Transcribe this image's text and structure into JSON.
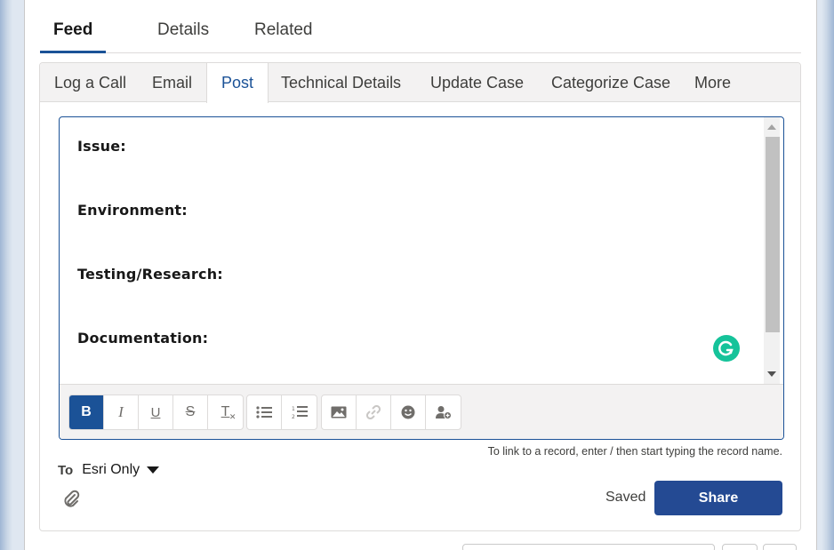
{
  "main_tabs": [
    {
      "label": "Feed"
    },
    {
      "label": "Details"
    },
    {
      "label": "Related"
    }
  ],
  "publisher_tabs": [
    {
      "label": "Log a Call"
    },
    {
      "label": "Email"
    },
    {
      "label": "Post"
    },
    {
      "label": "Technical Details"
    },
    {
      "label": "Update Case"
    },
    {
      "label": "Categorize Case"
    },
    {
      "label": "More"
    }
  ],
  "editor": {
    "fields": [
      "Issue:",
      "Environment:",
      "Testing/Research:",
      "Documentation:"
    ],
    "grammarly_icon": "G"
  },
  "toolbar": {
    "groups": [
      [
        "bold-icon",
        "italic-icon",
        "underline-icon",
        "strikethrough-icon",
        "clear-format-icon"
      ],
      [
        "bullet-list-icon",
        "numbered-list-icon"
      ],
      [
        "image-icon",
        "link-icon",
        "emoji-icon",
        "mention-icon"
      ]
    ],
    "bold": "B",
    "italic": "I",
    "underline": "U",
    "strike": "S",
    "clear": "T"
  },
  "hint": "To link to a record, enter / then start typing the record name.",
  "audience": {
    "label": "To",
    "value": "Esri Only"
  },
  "status": {
    "saved": "Saved"
  },
  "share_label": "Share",
  "colors": {
    "brand": "#1b5297",
    "share_button": "#244a93",
    "grammarly": "#15c39a"
  }
}
